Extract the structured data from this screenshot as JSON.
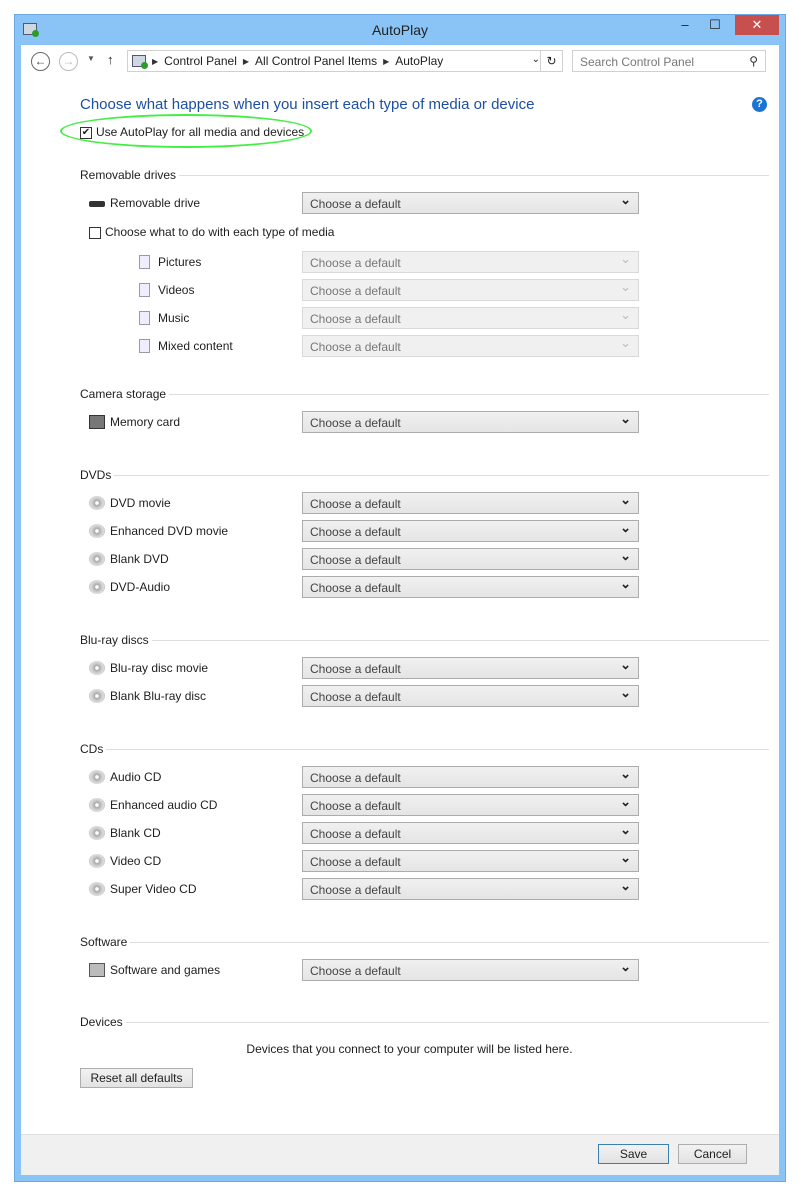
{
  "window": {
    "title": "AutoPlay",
    "minimize": "‒",
    "maximize": "☐",
    "close": "✕"
  },
  "nav": {
    "breadcrumb": [
      "Control Panel",
      "All Control Panel Items",
      "AutoPlay"
    ],
    "search_placeholder": "Search Control Panel"
  },
  "header": {
    "title": "Choose what happens when you insert each type of media or device",
    "help": "?"
  },
  "master_checkbox": {
    "label": "Use AutoPlay for all media and devices",
    "checked": true
  },
  "default_value": "Choose a default",
  "sections": {
    "removable": {
      "heading": "Removable drives",
      "drive": "Removable drive",
      "each_media": "Choose what to do with each type of media",
      "media": [
        "Pictures",
        "Videos",
        "Music",
        "Mixed content"
      ]
    },
    "camera": {
      "heading": "Camera storage",
      "items": [
        "Memory card"
      ]
    },
    "dvds": {
      "heading": "DVDs",
      "items": [
        "DVD movie",
        "Enhanced DVD movie",
        "Blank DVD",
        "DVD-Audio"
      ]
    },
    "bluray": {
      "heading": "Blu-ray discs",
      "items": [
        "Blu-ray disc movie",
        "Blank Blu-ray disc"
      ]
    },
    "cds": {
      "heading": "CDs",
      "items": [
        "Audio CD",
        "Enhanced audio CD",
        "Blank CD",
        "Video CD",
        "Super Video CD"
      ]
    },
    "software": {
      "heading": "Software",
      "items": [
        "Software and games"
      ]
    },
    "devices": {
      "heading": "Devices",
      "message": "Devices that you connect to your computer will be listed here."
    }
  },
  "buttons": {
    "reset": "Reset all defaults",
    "save": "Save",
    "cancel": "Cancel"
  },
  "colors": {
    "titlebar": "#8ac3f5",
    "close": "#c7504e",
    "heading": "#1d4fa3",
    "highlight": "#44ee44"
  }
}
